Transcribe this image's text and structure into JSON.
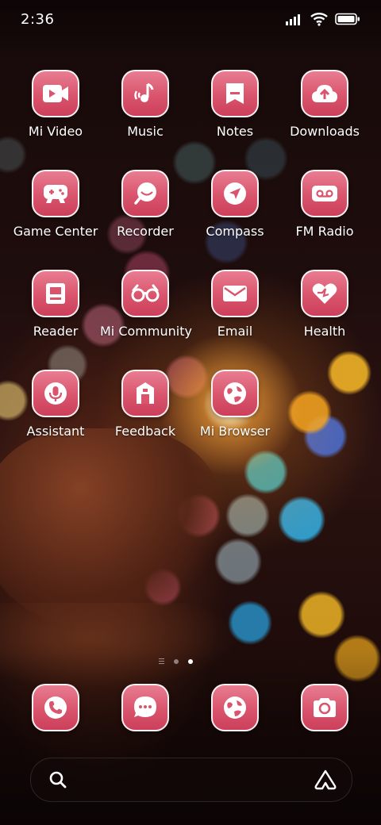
{
  "status": {
    "time": "2:36",
    "icons": [
      "signal-icon",
      "wifi-icon",
      "battery-icon"
    ]
  },
  "apps": [
    {
      "label": "Mi Video",
      "icon": "video-icon"
    },
    {
      "label": "Music",
      "icon": "music-icon"
    },
    {
      "label": "Notes",
      "icon": "notes-icon"
    },
    {
      "label": "Downloads",
      "icon": "download-icon"
    },
    {
      "label": "Game Center",
      "icon": "gamepad-icon"
    },
    {
      "label": "Recorder",
      "icon": "recorder-icon"
    },
    {
      "label": "Compass",
      "icon": "compass-icon"
    },
    {
      "label": "FM Radio",
      "icon": "radio-icon"
    },
    {
      "label": "Reader",
      "icon": "reader-icon"
    },
    {
      "label": "Mi Community",
      "icon": "community-icon"
    },
    {
      "label": "Email",
      "icon": "email-icon"
    },
    {
      "label": "Health",
      "icon": "health-icon"
    },
    {
      "label": "Assistant",
      "icon": "assistant-icon"
    },
    {
      "label": "Feedback",
      "icon": "feedback-icon"
    },
    {
      "label": "Mi Browser",
      "icon": "browser-icon"
    }
  ],
  "dock": [
    {
      "icon": "phone-icon"
    },
    {
      "icon": "messages-icon"
    },
    {
      "icon": "browser-icon"
    },
    {
      "icon": "camera-icon"
    }
  ],
  "pages": {
    "count": 2,
    "active": 2
  },
  "colors": {
    "icon_top": "#e87d92",
    "icon_bottom": "#cc3f5b",
    "text": "#ffffff"
  }
}
